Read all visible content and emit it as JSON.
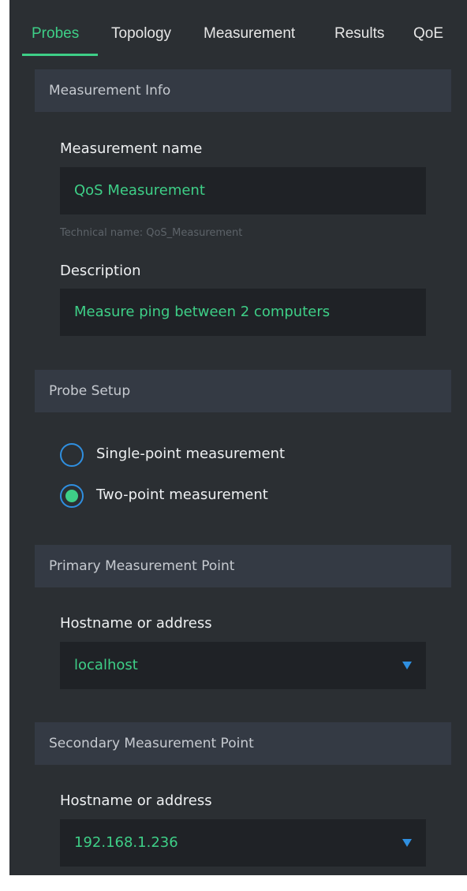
{
  "tabs": [
    {
      "label": "Probes",
      "active": true
    },
    {
      "label": "Topology"
    },
    {
      "label": "Measurement"
    },
    {
      "label": "Results"
    },
    {
      "label": "QoE"
    }
  ],
  "measurement_info": {
    "header": "Measurement Info",
    "name_label": "Measurement name",
    "name_value": "QoS Measurement",
    "technical_name": "Technical name: QoS_Measurement",
    "description_label": "Description",
    "description_value": "Measure ping between 2 computers"
  },
  "probe_setup": {
    "header": "Probe Setup",
    "options": [
      {
        "label": "Single-point measurement",
        "selected": false
      },
      {
        "label": "Two-point measurement",
        "selected": true
      }
    ]
  },
  "primary_point": {
    "header": "Primary Measurement Point",
    "host_label": "Hostname or address",
    "host_value": "localhost"
  },
  "secondary_point": {
    "header": "Secondary Measurement Point",
    "host_label": "Hostname or address",
    "host_value": "192.168.1.236"
  },
  "colors": {
    "accent_green": "#3ecf87",
    "accent_blue": "#2f8fe0",
    "panel_bg": "#2b2f33",
    "header_bg": "#343a44",
    "field_bg": "#1f2226"
  },
  "icons": {
    "dropdown": "caret-down-icon",
    "radio_on": "radio-selected-icon",
    "radio_off": "radio-unselected-icon"
  }
}
